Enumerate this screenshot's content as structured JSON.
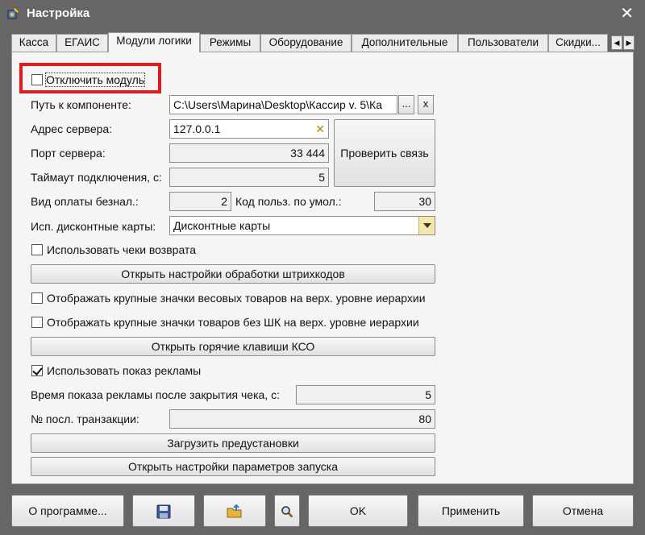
{
  "window": {
    "title": "Настройка",
    "close_glyph": "✕"
  },
  "tabs": [
    {
      "label": "Касса"
    },
    {
      "label": "ЕГАИС"
    },
    {
      "label": "Модули логики",
      "active": true
    },
    {
      "label": "Режимы"
    },
    {
      "label": "Оборудование"
    },
    {
      "label": "Дополнительные"
    },
    {
      "label": "Пользователи"
    },
    {
      "label": "Скидки..."
    }
  ],
  "tab_scroll": {
    "left": "◀",
    "right": "▶"
  },
  "form": {
    "disable_module": {
      "label": "Отключить модуль",
      "checked": false
    },
    "component_path": {
      "label": "Путь к компоненте:",
      "value": "C:\\Users\\Марина\\Desktop\\Кассир v. 5\\Ка",
      "browse": "...",
      "clear": "x"
    },
    "server_address": {
      "label": "Адрес сервера:",
      "value": "127.0.0.1"
    },
    "server_port": {
      "label": "Порт сервера:",
      "value": "33 444"
    },
    "check_connection": {
      "label": "Проверить связь"
    },
    "timeout": {
      "label": "Таймаут подключения, с:",
      "value": "5"
    },
    "noncash_payment": {
      "label": "Вид оплаты безнал.:",
      "value": "2"
    },
    "default_user_code": {
      "label": "Код польз. по умол.:",
      "value": "30"
    },
    "discount_cards": {
      "label": "Исп. дисконтные карты:",
      "value": "Дисконтные карты"
    },
    "use_return_receipts": {
      "label": "Использовать чеки возврата",
      "checked": false
    },
    "barcode_settings": {
      "label": "Открыть настройки обработки штрихкодов"
    },
    "large_weight_icons": {
      "label": "Отображать крупные значки весовых товаров на верх. уровне иерархии",
      "checked": false
    },
    "large_nobarcode_icons": {
      "label": "Отображать крупные значки товаров без ШК на верх. уровне иерархии",
      "checked": false
    },
    "hotkeys": {
      "label": "Открыть горячие клавиши КСО"
    },
    "use_ads": {
      "label": "Использовать показ рекламы",
      "checked": true
    },
    "ad_time": {
      "label": "Время показа рекламы после закрытия чека, с:",
      "value": "5"
    },
    "last_transaction": {
      "label": "№ посл. транзакции:",
      "value": "80"
    },
    "load_presets": {
      "label": "Загрузить предустановки"
    },
    "launch_params": {
      "label": "Открыть настройки параметров запуска"
    }
  },
  "footer": {
    "about": "О программе...",
    "ok": "OK",
    "apply": "Применить",
    "cancel": "Отмена"
  }
}
